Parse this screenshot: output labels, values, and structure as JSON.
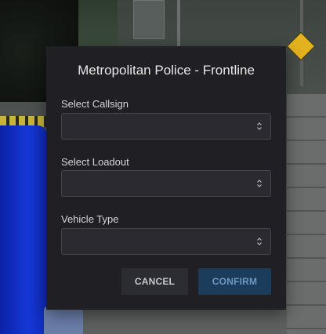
{
  "modal": {
    "title": "Metropolitan Police - Frontline",
    "fields": [
      {
        "label": "Select Callsign",
        "value": "",
        "icon": "chevron-updown-icon"
      },
      {
        "label": "Select Loadout",
        "value": "",
        "icon": "chevron-updown-icon"
      },
      {
        "label": "Vehicle Type",
        "value": "",
        "icon": "chevron-updown-icon"
      }
    ],
    "cancel_label": "CANCEL",
    "confirm_label": "CONFIRM"
  },
  "colors": {
    "modal_bg": "#1f1f24",
    "select_bg": "#2a2a30",
    "confirm_bg": "#1c3c5c",
    "confirm_text": "#6f99c2",
    "cancel_bg": "#2c2c33"
  }
}
